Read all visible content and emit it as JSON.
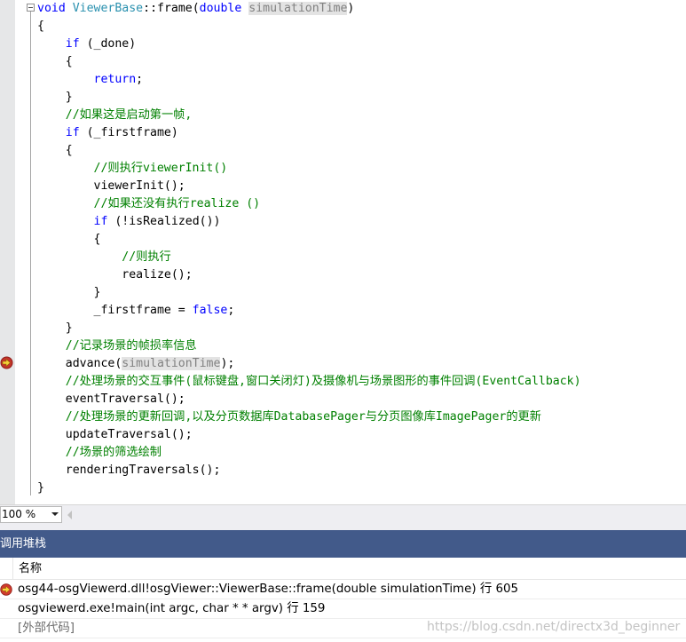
{
  "editor": {
    "lines": [
      [
        {
          "t": "void",
          "c": "kw"
        },
        {
          "t": " "
        },
        {
          "t": "ViewerBase",
          "c": "type"
        },
        {
          "t": "::frame("
        },
        {
          "t": "double",
          "c": "kw"
        },
        {
          "t": " "
        },
        {
          "t": "simulationTime",
          "c": "hlp"
        },
        {
          "t": ")"
        }
      ],
      [
        {
          "t": "{"
        }
      ],
      [
        {
          "t": "    "
        },
        {
          "t": "if",
          "c": "kw"
        },
        {
          "t": " (_done)"
        }
      ],
      [
        {
          "t": "    {"
        }
      ],
      [
        {
          "t": "        "
        },
        {
          "t": "return",
          "c": "kw"
        },
        {
          "t": ";"
        }
      ],
      [
        {
          "t": "    }"
        }
      ],
      [
        {
          "t": "    "
        },
        {
          "t": "//如果这是启动第一帧,",
          "c": "cm"
        }
      ],
      [
        {
          "t": "    "
        },
        {
          "t": "if",
          "c": "kw"
        },
        {
          "t": " (_firstframe)"
        }
      ],
      [
        {
          "t": "    {"
        }
      ],
      [
        {
          "t": "        "
        },
        {
          "t": "//则执行viewerInit()",
          "c": "cm"
        }
      ],
      [
        {
          "t": "        viewerInit();"
        }
      ],
      [
        {
          "t": "        "
        },
        {
          "t": "//如果还没有执行realize ()",
          "c": "cm"
        }
      ],
      [
        {
          "t": "        "
        },
        {
          "t": "if",
          "c": "kw"
        },
        {
          "t": " (!isRealized())"
        }
      ],
      [
        {
          "t": "        {"
        }
      ],
      [
        {
          "t": "            "
        },
        {
          "t": "//则执行",
          "c": "cm"
        }
      ],
      [
        {
          "t": "            realize();"
        }
      ],
      [
        {
          "t": "        }"
        }
      ],
      [
        {
          "t": "        _firstframe = "
        },
        {
          "t": "false",
          "c": "kw"
        },
        {
          "t": ";"
        }
      ],
      [
        {
          "t": "    }"
        }
      ],
      [
        {
          "t": "    "
        },
        {
          "t": "//记录场景的帧损率信息",
          "c": "cm"
        }
      ],
      [
        {
          "t": "    advance("
        },
        {
          "t": "simulationTime",
          "c": "hlp"
        },
        {
          "t": ");"
        }
      ],
      [
        {
          "t": "    "
        },
        {
          "t": "//处理场景的交互事件(鼠标键盘,窗口关闭灯)及摄像机与场景图形的事件回调(EventCallback)",
          "c": "cm"
        }
      ],
      [
        {
          "t": "    eventTraversal();"
        }
      ],
      [
        {
          "t": "    "
        },
        {
          "t": "//处理场景的更新回调,以及分页数据库DatabasePager与分页图像库ImagePager的更新",
          "c": "cm"
        }
      ],
      [
        {
          "t": "    updateTraversal();"
        }
      ],
      [
        {
          "t": "    "
        },
        {
          "t": "//场景的筛选绘制",
          "c": "cm"
        }
      ],
      [
        {
          "t": "    renderingTraversals();"
        }
      ],
      [
        {
          "t": "}"
        }
      ]
    ]
  },
  "status": {
    "zoom": "100 %"
  },
  "call_stack": {
    "title": "调用堆栈",
    "column_name": "名称",
    "rows": [
      {
        "text": "osg44-osgViewerd.dll!osgViewer::ViewerBase::frame(double simulationTime) 行 605",
        "current": true
      },
      {
        "text": "osgviewerd.exe!main(int argc, char * * argv) 行 159",
        "current": false
      },
      {
        "text": "[外部代码]",
        "current": false,
        "external": true
      }
    ]
  },
  "watermark": "https://blog.csdn.net/directx3d_beginner",
  "colors": {
    "keyword": "#0000ff",
    "type": "#2b91af",
    "comment": "#008000",
    "panel_title": "#425a8a",
    "gutter": "#e6e7e8"
  },
  "icons": {
    "current_line": "breakpoint-arrow-icon",
    "call_stack_current": "current-frame-arrow-icon"
  }
}
